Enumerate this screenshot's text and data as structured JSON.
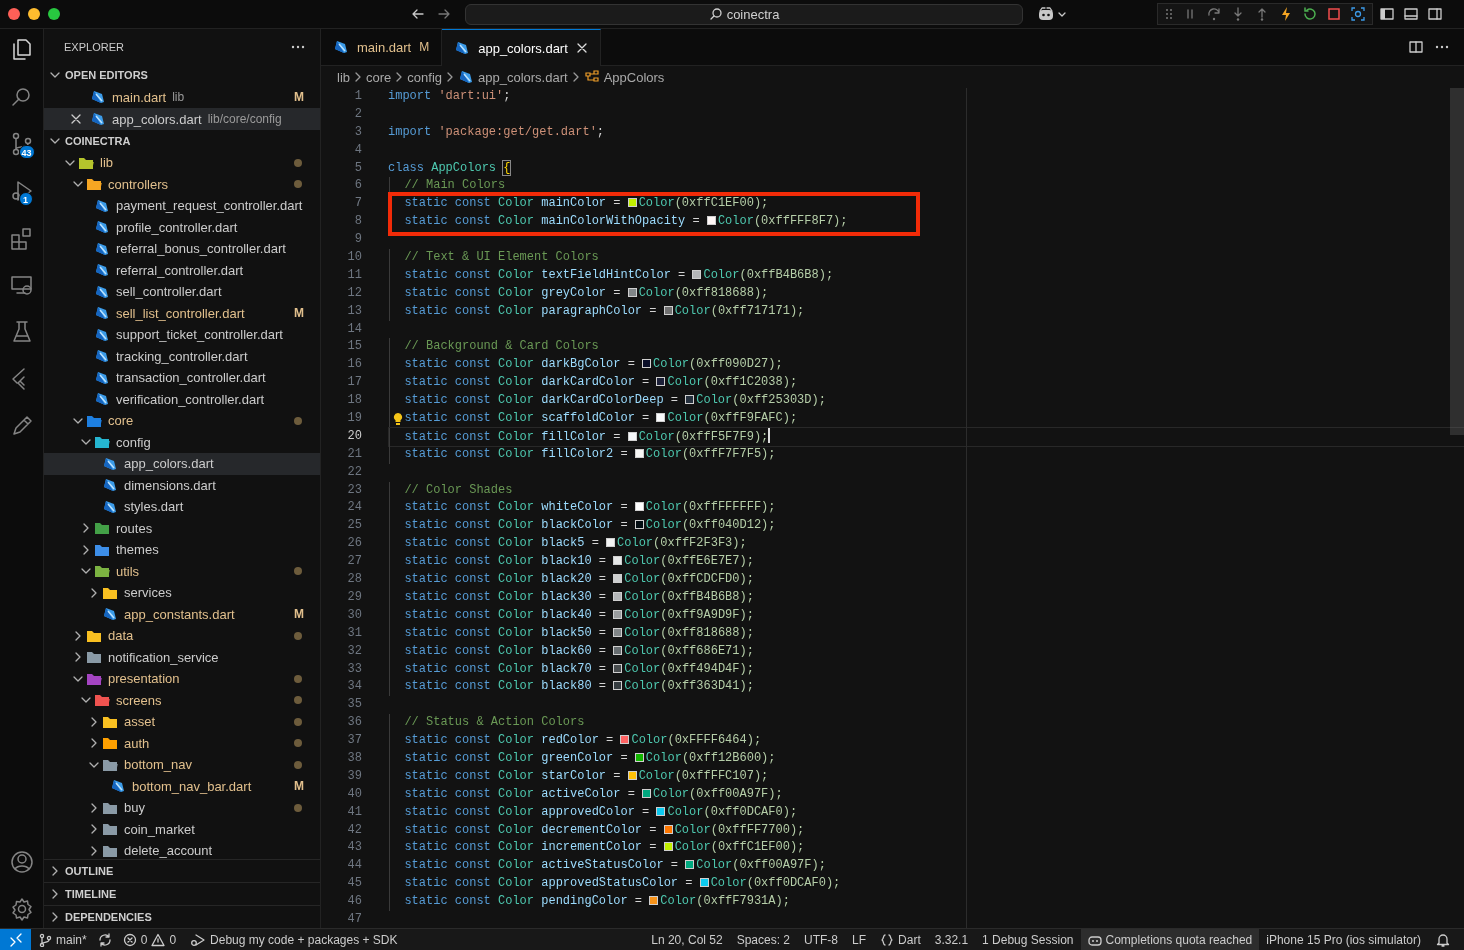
{
  "title_bar": {
    "search": "coinectra"
  },
  "activity_bar": {
    "source_control_badge": "43",
    "run_debug_badge": "1"
  },
  "explorer": {
    "title": "EXPLORER",
    "open_editors": {
      "title": "OPEN EDITORS",
      "expanded": true,
      "items": [
        {
          "name": "main.dart",
          "path": "lib",
          "badge": "M",
          "modified": true,
          "selected": false
        },
        {
          "name": "app_colors.dart",
          "path": "lib/core/config",
          "modified": false,
          "selected": true
        }
      ]
    },
    "project": {
      "title": "COINECTRA",
      "expanded": true,
      "tree": [
        {
          "kind": "folder",
          "label": "lib",
          "color": "#b5c42c",
          "expanded": true,
          "modified": true,
          "dot": true,
          "selected": false,
          "children": [
            {
              "kind": "folder",
              "label": "controllers",
              "color": "#f5a623",
              "expanded": true,
              "modified": true,
              "dot": true,
              "selected": false,
              "children": [
                {
                  "kind": "file",
                  "label": "payment_request_controller.dart",
                  "modified": false,
                  "selected": false
                },
                {
                  "kind": "file",
                  "label": "profile_controller.dart",
                  "modified": false,
                  "selected": false
                },
                {
                  "kind": "file",
                  "label": "referral_bonus_controller.dart",
                  "modified": false,
                  "selected": false
                },
                {
                  "kind": "file",
                  "label": "referral_controller.dart",
                  "modified": false,
                  "selected": false
                },
                {
                  "kind": "file",
                  "label": "sell_controller.dart",
                  "modified": false,
                  "selected": false
                },
                {
                  "kind": "file",
                  "label": "sell_list_controller.dart",
                  "modified": true,
                  "badge": "M",
                  "selected": false
                },
                {
                  "kind": "file",
                  "label": "support_ticket_controller.dart",
                  "modified": false,
                  "selected": false
                },
                {
                  "kind": "file",
                  "label": "tracking_controller.dart",
                  "modified": false,
                  "selected": false
                },
                {
                  "kind": "file",
                  "label": "transaction_controller.dart",
                  "modified": false,
                  "selected": false
                },
                {
                  "kind": "file",
                  "label": "verification_controller.dart",
                  "modified": false,
                  "selected": false
                }
              ]
            },
            {
              "kind": "folder",
              "label": "core",
              "color": "#1e7fe0",
              "expanded": true,
              "modified": true,
              "dot": true,
              "selected": false,
              "children": [
                {
                  "kind": "folder",
                  "label": "config",
                  "color": "#26b5d0",
                  "expanded": true,
                  "modified": false,
                  "dot": false,
                  "selected": false,
                  "children": [
                    {
                      "kind": "file",
                      "label": "app_colors.dart",
                      "modified": false,
                      "selected": true
                    },
                    {
                      "kind": "file",
                      "label": "dimensions.dart",
                      "modified": false,
                      "selected": false
                    },
                    {
                      "kind": "file",
                      "label": "styles.dart",
                      "modified": false,
                      "selected": false
                    }
                  ]
                },
                {
                  "kind": "folder",
                  "label": "routes",
                  "color": "#43a047",
                  "expanded": false,
                  "modified": false,
                  "dot": false,
                  "selected": false
                },
                {
                  "kind": "folder",
                  "label": "themes",
                  "color": "#3d8ee8",
                  "expanded": false,
                  "modified": false,
                  "dot": false,
                  "selected": false
                },
                {
                  "kind": "folder",
                  "label": "utils",
                  "color": "#7cb342",
                  "expanded": true,
                  "modified": true,
                  "dot": true,
                  "selected": false,
                  "children": [
                    {
                      "kind": "folder",
                      "label": "services",
                      "color": "#f9c021",
                      "expanded": false,
                      "modified": false,
                      "dot": false,
                      "selected": false
                    },
                    {
                      "kind": "file",
                      "label": "app_constants.dart",
                      "modified": true,
                      "badge": "M",
                      "selected": false
                    }
                  ]
                }
              ]
            },
            {
              "kind": "folder",
              "label": "data",
              "color": "#f9c021",
              "expanded": false,
              "modified": true,
              "dot": true,
              "selected": false
            },
            {
              "kind": "folder",
              "label": "notification_service",
              "color": "#8a9aa6",
              "expanded": false,
              "modified": false,
              "dot": false,
              "selected": false
            },
            {
              "kind": "folder",
              "label": "presentation",
              "color": "#a545c2",
              "expanded": true,
              "modified": true,
              "dot": true,
              "selected": false,
              "children": [
                {
                  "kind": "folder",
                  "label": "screens",
                  "color": "#ef5350",
                  "expanded": true,
                  "modified": true,
                  "dot": true,
                  "selected": false,
                  "children": [
                    {
                      "kind": "folder",
                      "label": "asset",
                      "color": "#f9c021",
                      "expanded": false,
                      "modified": true,
                      "dot": true,
                      "selected": false
                    },
                    {
                      "kind": "folder",
                      "label": "auth",
                      "color": "#ffa000",
                      "expanded": false,
                      "modified": true,
                      "dot": true,
                      "selected": false
                    },
                    {
                      "kind": "folder",
                      "label": "bottom_nav",
                      "color": "#8a9aa6",
                      "expanded": true,
                      "modified": true,
                      "dot": true,
                      "selected": false,
                      "children": [
                        {
                          "kind": "file",
                          "label": "bottom_nav_bar.dart",
                          "modified": true,
                          "badge": "M",
                          "selected": false
                        }
                      ]
                    },
                    {
                      "kind": "folder",
                      "label": "buy",
                      "color": "#8a9aa6",
                      "expanded": false,
                      "modified": false,
                      "dot": true,
                      "selected": false
                    },
                    {
                      "kind": "folder",
                      "label": "coin_market",
                      "color": "#8a9aa6",
                      "expanded": false,
                      "modified": false,
                      "dot": false,
                      "selected": false
                    },
                    {
                      "kind": "folder",
                      "label": "delete_account",
                      "color": "#8a9aa6",
                      "expanded": false,
                      "modified": false,
                      "dot": false,
                      "selected": false
                    }
                  ]
                }
              ]
            }
          ]
        }
      ]
    },
    "sections": [
      {
        "title": "OUTLINE",
        "expanded": false
      },
      {
        "title": "TIMELINE",
        "expanded": false
      },
      {
        "title": "DEPENDENCIES",
        "expanded": false
      }
    ]
  },
  "tabs": [
    {
      "label": "main.dart",
      "badge": "M",
      "modified": true,
      "selected": false
    },
    {
      "label": "app_colors.dart",
      "modified": false,
      "selected": true
    }
  ],
  "breadcrumb": [
    {
      "kind": "folder",
      "label": "lib"
    },
    {
      "kind": "folder",
      "label": "core"
    },
    {
      "kind": "folder",
      "label": "config"
    },
    {
      "kind": "file",
      "label": "app_colors.dart"
    },
    {
      "kind": "class",
      "label": "AppColors"
    }
  ],
  "editor": {
    "lines": [
      {
        "n": "1",
        "kind": "import",
        "kw": "import",
        "str": "'dart:ui'",
        "end": ";",
        "current": false,
        "lightbulb": false
      },
      {
        "n": "2",
        "kind": "blank",
        "current": false,
        "lightbulb": false
      },
      {
        "n": "3",
        "kind": "import",
        "kw": "import",
        "str": "'package:get/get.dart'",
        "end": ";",
        "current": false,
        "lightbulb": false
      },
      {
        "n": "4",
        "kind": "blank",
        "current": false,
        "lightbulb": false
      },
      {
        "n": "5",
        "kind": "class",
        "kw": "class",
        "name": "AppColors",
        "brace": "{",
        "current": false,
        "lightbulb": false
      },
      {
        "n": "6",
        "kind": "comment",
        "text": "// Main Colors",
        "current": false,
        "lightbulb": false
      },
      {
        "n": "7",
        "kind": "decl",
        "mods": "static const",
        "type": "Color",
        "name": "mainColor",
        "eq": "=",
        "color": "#c1ef00",
        "ctor": "Color",
        "args": "(0xffC1EF00);",
        "current": false,
        "lightbulb": false
      },
      {
        "n": "8",
        "kind": "decl",
        "mods": "static const",
        "type": "Color",
        "name": "mainColorWithOpacity",
        "eq": "=",
        "color": "#fff8f7",
        "ctor": "Color",
        "args": "(0xffFFF8F7);",
        "current": false,
        "lightbulb": false
      },
      {
        "n": "9",
        "kind": "blank",
        "current": false,
        "lightbulb": false
      },
      {
        "n": "10",
        "kind": "comment",
        "text": "// Text & UI Element Colors",
        "current": false,
        "lightbulb": false
      },
      {
        "n": "11",
        "kind": "decl",
        "mods": "static const",
        "type": "Color",
        "name": "textFieldHintColor",
        "eq": "=",
        "color": "#b4b6b8",
        "ctor": "Color",
        "args": "(0xffB4B6B8);",
        "current": false,
        "lightbulb": false
      },
      {
        "n": "12",
        "kind": "decl",
        "mods": "static const",
        "type": "Color",
        "name": "greyColor",
        "eq": "=",
        "color": "#818688",
        "ctor": "Color",
        "args": "(0xff818688);",
        "current": false,
        "lightbulb": false
      },
      {
        "n": "13",
        "kind": "decl",
        "mods": "static const",
        "type": "Color",
        "name": "paragraphColor",
        "eq": "=",
        "color": "#717171",
        "ctor": "Color",
        "args": "(0xff717171);",
        "current": false,
        "lightbulb": false
      },
      {
        "n": "14",
        "kind": "blank",
        "current": false,
        "lightbulb": false
      },
      {
        "n": "15",
        "kind": "comment",
        "text": "// Background & Card Colors",
        "current": false,
        "lightbulb": false
      },
      {
        "n": "16",
        "kind": "decl",
        "mods": "static const",
        "type": "Color",
        "name": "darkBgColor",
        "eq": "=",
        "color": "#090d27",
        "ctor": "Color",
        "args": "(0xff090D27);",
        "current": false,
        "lightbulb": false
      },
      {
        "n": "17",
        "kind": "decl",
        "mods": "static const",
        "type": "Color",
        "name": "darkCardColor",
        "eq": "=",
        "color": "#1c2038",
        "ctor": "Color",
        "args": "(0xff1C2038);",
        "current": false,
        "lightbulb": false
      },
      {
        "n": "18",
        "kind": "decl",
        "mods": "static const",
        "type": "Color",
        "name": "darkCardColorDeep",
        "eq": "=",
        "color": "#25303d",
        "ctor": "Color",
        "args": "(0xff25303D);",
        "current": false,
        "lightbulb": false
      },
      {
        "n": "19",
        "kind": "decl",
        "mods": "static const",
        "type": "Color",
        "name": "scaffoldColor",
        "eq": "=",
        "color": "#f9fafc",
        "ctor": "Color",
        "args": "(0xffF9FAFC);",
        "current": false,
        "lightbulb": true
      },
      {
        "n": "20",
        "kind": "decl",
        "mods": "static const",
        "type": "Color",
        "name": "fillColor",
        "eq": "=",
        "color": "#f5f7f9",
        "ctor": "Color",
        "args": "(0xffF5F7F9);",
        "current": true,
        "lightbulb": false
      },
      {
        "n": "21",
        "kind": "decl",
        "mods": "static const",
        "type": "Color",
        "name": "fillColor2",
        "eq": "=",
        "color": "#f7f7f5",
        "ctor": "Color",
        "args": "(0xffF7F7F5);",
        "current": false,
        "lightbulb": false
      },
      {
        "n": "22",
        "kind": "blank",
        "current": false,
        "lightbulb": false
      },
      {
        "n": "23",
        "kind": "comment",
        "text": "// Color Shades",
        "current": false,
        "lightbulb": false
      },
      {
        "n": "24",
        "kind": "decl",
        "mods": "static const",
        "type": "Color",
        "name": "whiteColor",
        "eq": "=",
        "color": "#ffffff",
        "ctor": "Color",
        "args": "(0xffFFFFFF);",
        "current": false,
        "lightbulb": false
      },
      {
        "n": "25",
        "kind": "decl",
        "mods": "static const",
        "type": "Color",
        "name": "blackColor",
        "eq": "=",
        "color": "#040d12",
        "ctor": "Color",
        "args": "(0xff040D12);",
        "current": false,
        "lightbulb": false
      },
      {
        "n": "26",
        "kind": "decl",
        "mods": "static const",
        "type": "Color",
        "name": "black5",
        "eq": "=",
        "color": "#f2f3f3",
        "ctor": "Color",
        "args": "(0xffF2F3F3);",
        "current": false,
        "lightbulb": false
      },
      {
        "n": "27",
        "kind": "decl",
        "mods": "static const",
        "type": "Color",
        "name": "black10",
        "eq": "=",
        "color": "#e6e7e7",
        "ctor": "Color",
        "args": "(0xffE6E7E7);",
        "current": false,
        "lightbulb": false
      },
      {
        "n": "28",
        "kind": "decl",
        "mods": "static const",
        "type": "Color",
        "name": "black20",
        "eq": "=",
        "color": "#cdcfd0",
        "ctor": "Color",
        "args": "(0xffCDCFD0);",
        "current": false,
        "lightbulb": false
      },
      {
        "n": "29",
        "kind": "decl",
        "mods": "static const",
        "type": "Color",
        "name": "black30",
        "eq": "=",
        "color": "#b4b6b8",
        "ctor": "Color",
        "args": "(0xffB4B6B8);",
        "current": false,
        "lightbulb": false
      },
      {
        "n": "30",
        "kind": "decl",
        "mods": "static const",
        "type": "Color",
        "name": "black40",
        "eq": "=",
        "color": "#9a9d9f",
        "ctor": "Color",
        "args": "(0xff9A9D9F);",
        "current": false,
        "lightbulb": false
      },
      {
        "n": "31",
        "kind": "decl",
        "mods": "static const",
        "type": "Color",
        "name": "black50",
        "eq": "=",
        "color": "#818688",
        "ctor": "Color",
        "args": "(0xff818688);",
        "current": false,
        "lightbulb": false
      },
      {
        "n": "32",
        "kind": "decl",
        "mods": "static const",
        "type": "Color",
        "name": "black60",
        "eq": "=",
        "color": "#686e71",
        "ctor": "Color",
        "args": "(0xff686E71);",
        "current": false,
        "lightbulb": false
      },
      {
        "n": "33",
        "kind": "decl",
        "mods": "static const",
        "type": "Color",
        "name": "black70",
        "eq": "=",
        "color": "#494d4f",
        "ctor": "Color",
        "args": "(0xff494D4F);",
        "current": false,
        "lightbulb": false
      },
      {
        "n": "34",
        "kind": "decl",
        "mods": "static const",
        "type": "Color",
        "name": "black80",
        "eq": "=",
        "color": "#363d41",
        "ctor": "Color",
        "args": "(0xff363D41);",
        "current": false,
        "lightbulb": false
      },
      {
        "n": "35",
        "kind": "blank",
        "current": false,
        "lightbulb": false
      },
      {
        "n": "36",
        "kind": "comment",
        "text": "// Status & Action Colors",
        "current": false,
        "lightbulb": false
      },
      {
        "n": "37",
        "kind": "decl",
        "mods": "static const",
        "type": "Color",
        "name": "redColor",
        "eq": "=",
        "color": "#ff6464",
        "ctor": "Color",
        "args": "(0xFFFF6464);",
        "current": false,
        "lightbulb": false
      },
      {
        "n": "38",
        "kind": "decl",
        "mods": "static const",
        "type": "Color",
        "name": "greenColor",
        "eq": "=",
        "color": "#12b600",
        "ctor": "Color",
        "args": "(0xff12B600);",
        "current": false,
        "lightbulb": false
      },
      {
        "n": "39",
        "kind": "decl",
        "mods": "static const",
        "type": "Color",
        "name": "starColor",
        "eq": "=",
        "color": "#ffc107",
        "ctor": "Color",
        "args": "(0xffFFC107);",
        "current": false,
        "lightbulb": false
      },
      {
        "n": "40",
        "kind": "decl",
        "mods": "static const",
        "type": "Color",
        "name": "activeColor",
        "eq": "=",
        "color": "#00a97f",
        "ctor": "Color",
        "args": "(0xff00A97F);",
        "current": false,
        "lightbulb": false
      },
      {
        "n": "41",
        "kind": "decl",
        "mods": "static const",
        "type": "Color",
        "name": "approvedColor",
        "eq": "=",
        "color": "#0dcaf0",
        "ctor": "Color",
        "args": "(0xff0DCAF0);",
        "current": false,
        "lightbulb": false
      },
      {
        "n": "42",
        "kind": "decl",
        "mods": "static const",
        "type": "Color",
        "name": "decrementColor",
        "eq": "=",
        "color": "#ff7700",
        "ctor": "Color",
        "args": "(0xffFF7700);",
        "current": false,
        "lightbulb": false
      },
      {
        "n": "43",
        "kind": "decl",
        "mods": "static const",
        "type": "Color",
        "name": "incrementColor",
        "eq": "=",
        "color": "#c1ef00",
        "ctor": "Color",
        "args": "(0xffC1EF00);",
        "current": false,
        "lightbulb": false
      },
      {
        "n": "44",
        "kind": "decl",
        "mods": "static const",
        "type": "Color",
        "name": "activeStatusColor",
        "eq": "=",
        "color": "#00a97f",
        "ctor": "Color",
        "args": "(0xff00A97F);",
        "current": false,
        "lightbulb": false
      },
      {
        "n": "45",
        "kind": "decl",
        "mods": "static const",
        "type": "Color",
        "name": "approvedStatusColor",
        "eq": "=",
        "color": "#0dcaf0",
        "ctor": "Color",
        "args": "(0xff0DCAF0);",
        "current": false,
        "lightbulb": false
      },
      {
        "n": "46",
        "kind": "decl",
        "mods": "static const",
        "type": "Color",
        "name": "pendingColor",
        "eq": "=",
        "color": "#f7931a",
        "ctor": "Color",
        "args": "(0xffF7931A);",
        "current": false,
        "lightbulb": false
      },
      {
        "n": "47",
        "kind": "blank",
        "current": false,
        "lightbulb": false
      }
    ]
  },
  "status_bar": {
    "branch": "main*",
    "errors": "0",
    "warnings": "0",
    "debug_config": "Debug my code + packages + SDK",
    "right": [
      {
        "kind": "plain",
        "text": "Ln 20, Col 52"
      },
      {
        "kind": "plain",
        "text": "Spaces: 2"
      },
      {
        "kind": "plain",
        "text": "UTF-8"
      },
      {
        "kind": "plain",
        "text": "LF"
      },
      {
        "kind": "language",
        "text": "Dart"
      },
      {
        "kind": "plain",
        "text": "3.32.1"
      },
      {
        "kind": "plain",
        "text": "1 Debug Session"
      },
      {
        "kind": "quota",
        "text": "Completions quota reached"
      },
      {
        "kind": "plain",
        "text": "iPhone 15 Pro (ios simulator)"
      }
    ]
  }
}
